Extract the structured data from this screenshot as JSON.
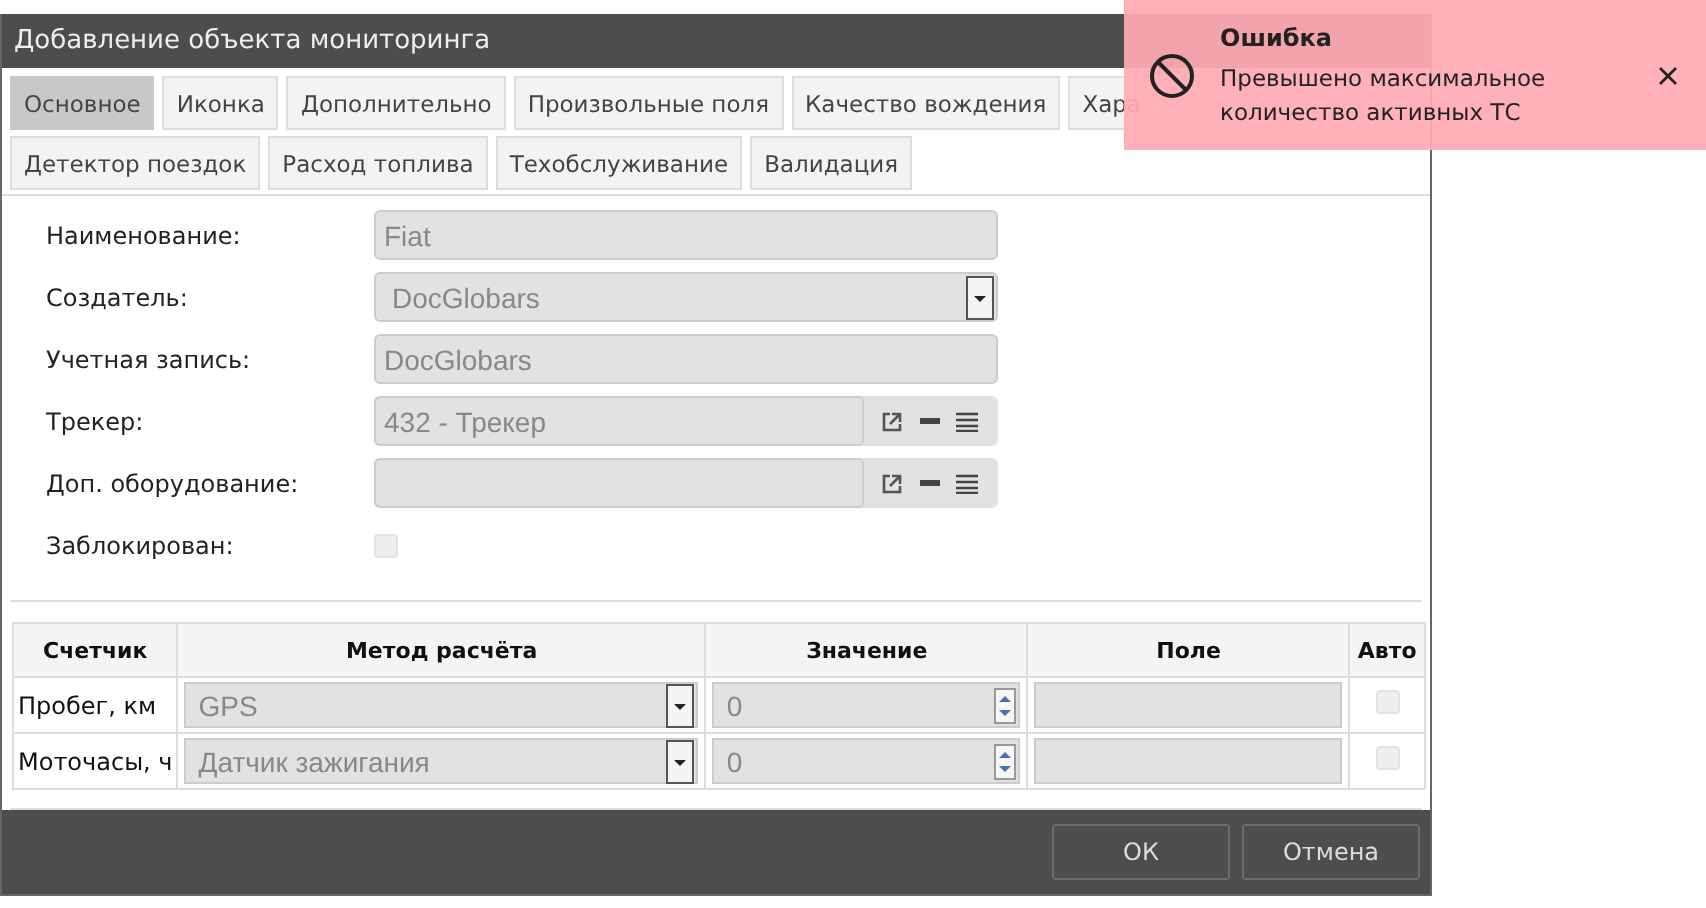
{
  "dialog": {
    "title": "Добавление объекта мониторинга"
  },
  "tabs": [
    [
      {
        "label": "Основное",
        "selected": true
      },
      {
        "label": "Иконка",
        "selected": false
      },
      {
        "label": "Дополнительно",
        "selected": false
      },
      {
        "label": "Произвольные поля",
        "selected": false
      },
      {
        "label": "Качество вождения",
        "selected": false
      },
      {
        "label": "Хара",
        "selected": false
      }
    ],
    [
      {
        "label": "Детектор поездок",
        "selected": false
      },
      {
        "label": "Расход топлива",
        "selected": false
      },
      {
        "label": "Техобслуживание",
        "selected": false
      },
      {
        "label": "Валидация",
        "selected": false
      }
    ]
  ],
  "form": [
    {
      "label": "Наименование:",
      "kind": "text",
      "value": "Fiat"
    },
    {
      "label": "Создатель:",
      "kind": "select",
      "value": "DocGlobars"
    },
    {
      "label": "Учетная запись:",
      "kind": "text",
      "value": "DocGlobars"
    },
    {
      "label": "Трекер:",
      "kind": "picker",
      "value": "432 - Трекер"
    },
    {
      "label": "Доп. оборудование:",
      "kind": "picker"
    },
    {
      "label": "Заблокирован:",
      "kind": "checkbox",
      "checked": false
    }
  ],
  "counters": {
    "columns": [
      "Счетчик",
      "Метод расчёта",
      "Значение",
      "Поле",
      "Авто"
    ],
    "rows": [
      {
        "counter": "Пробег, км",
        "method": "GPS",
        "value": "0",
        "auto": false
      },
      {
        "counter": "Моточасы, ч",
        "method": "Датчик зажигания",
        "value": "0",
        "auto": false
      }
    ]
  },
  "buttons": [
    "ОК",
    "Отмена"
  ],
  "toast": {
    "title": "Ошибка",
    "message": "Превышено максимальное количество активных ТС"
  }
}
